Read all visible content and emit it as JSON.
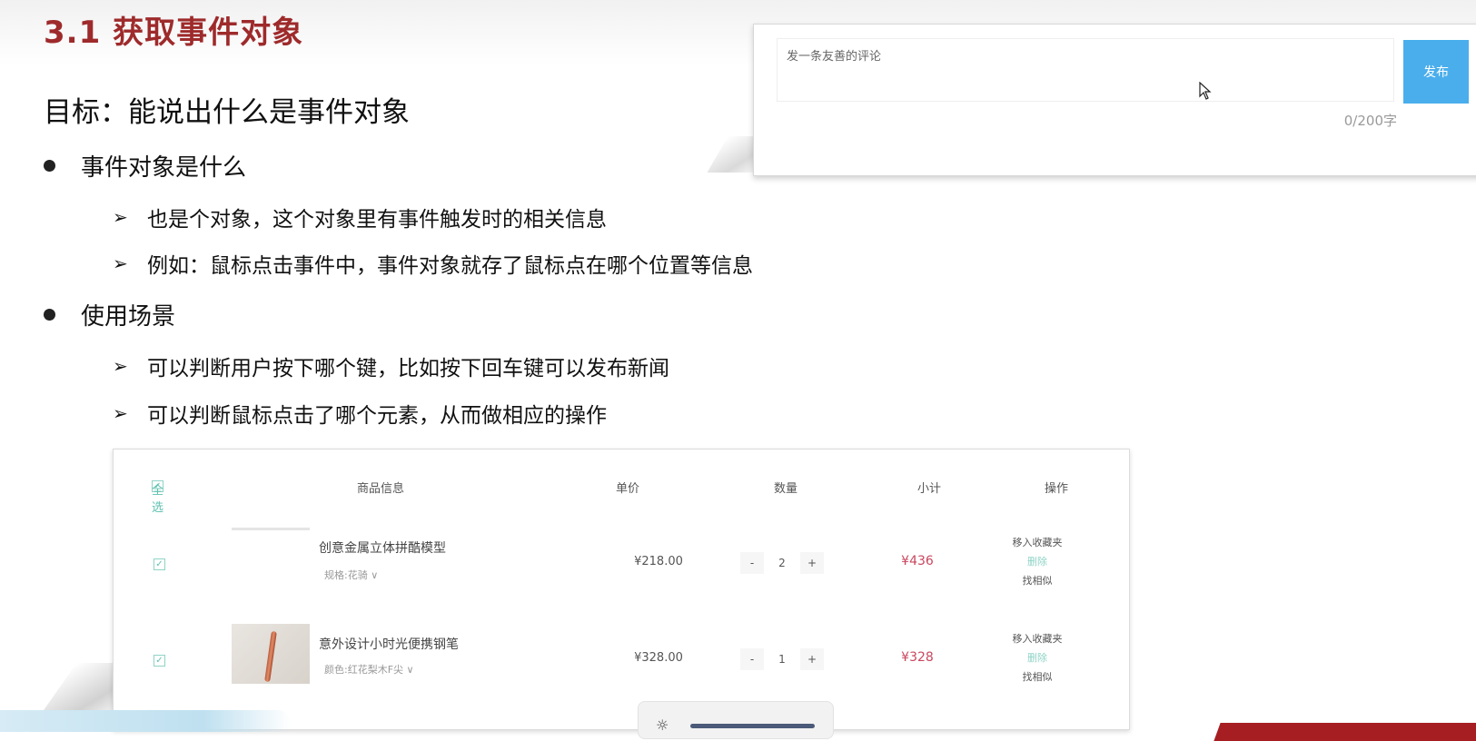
{
  "slide": {
    "title": "3.1 获取事件对象",
    "goal": "目标：能说出什么是事件对象",
    "bullets": [
      {
        "text": "事件对象是什么",
        "subs": [
          "也是个对象，这个对象里有事件触发时的相关信息",
          "例如：鼠标点击事件中，事件对象就存了鼠标点在哪个位置等信息"
        ]
      },
      {
        "text": "使用场景",
        "subs": [
          "可以判断用户按下哪个键，比如按下回车键可以发布新闻",
          "可以判断鼠标点击了哪个元素，从而做相应的操作"
        ]
      }
    ]
  },
  "comment": {
    "placeholder": "发一条友善的评论",
    "publish_label": "发布",
    "count": "0/200字"
  },
  "cart": {
    "headers": {
      "select_all": "全选",
      "info": "商品信息",
      "price": "单价",
      "qty": "数量",
      "subtotal": "小计",
      "ops": "操作"
    },
    "rows": [
      {
        "name": "创意金属立体拼酷模型",
        "spec": "规格:花骑 ∨",
        "price": "¥218.00",
        "qty": "2",
        "subtotal": "¥436",
        "op_fav": "移入收藏夹",
        "op_del": "删除",
        "op_similar": "找相似",
        "minus": "-",
        "plus": "+"
      },
      {
        "name": "意外设计小时光便携钢笔",
        "spec": "颜色:红花梨木F尖 ∨",
        "price": "¥328.00",
        "qty": "1",
        "subtotal": "¥328",
        "op_fav": "移入收藏夹",
        "op_del": "删除",
        "op_similar": "找相似",
        "minus": "-",
        "plus": "+"
      }
    ]
  },
  "colors": {
    "title": "#9e2a2b",
    "publish": "#4aaeec",
    "subtotal": "#c9475f",
    "accent": "#5ec1b0"
  },
  "icons": {
    "bullet": "dot-icon",
    "sub": "arrow-right-icon",
    "checkbox": "checkbox-icon",
    "cursor": "cursor-icon",
    "brightness": "sun-icon"
  }
}
